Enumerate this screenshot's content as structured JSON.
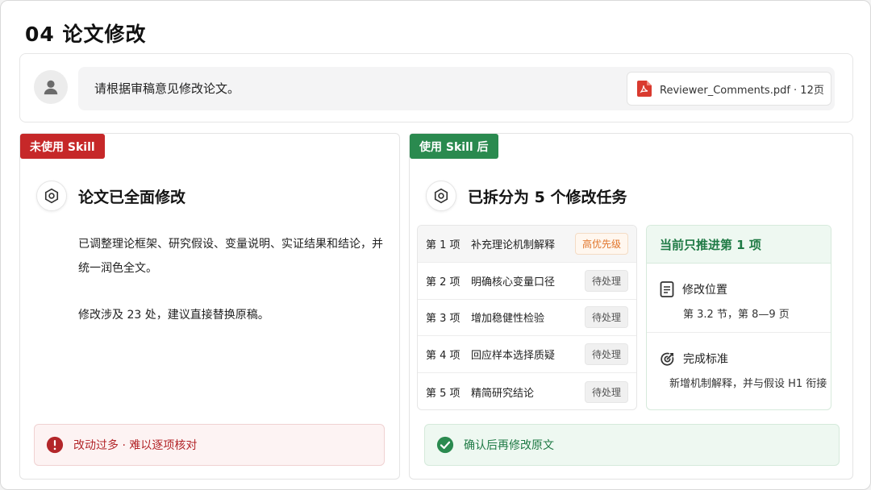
{
  "page": {
    "title": "04 论文修改"
  },
  "prompt": {
    "text": "请根据审稿意见修改论文。",
    "file_name": "Reviewer_Comments.pdf · 12页",
    "file_icon": "pdf-icon",
    "avatar_icon": "user-icon"
  },
  "left_panel": {
    "tag": "未使用 Skill",
    "tag_color": "#c62829",
    "heading": "论文已全面修改",
    "paragraphs": [
      "已调整理论框架、研究假设、变量说明、实证结果和结论，并统一润色全文。",
      "修改涉及 23 处，建议直接替换原稿。"
    ],
    "alert": "改动过多 · 难以逐项核对",
    "alert_icon": "exclamation-circle-icon"
  },
  "right_panel": {
    "tag": "使用 Skill 后",
    "tag_color": "#2a8a4f",
    "heading": "已拆分为 5 个修改任务",
    "tasks": [
      {
        "num": "第 1 项",
        "name": "补充理论机制解释",
        "status": "高优先级"
      },
      {
        "num": "第 2 项",
        "name": "明确核心变量口径",
        "status": "待处理"
      },
      {
        "num": "第 3 项",
        "name": "增加稳健性检验",
        "status": "待处理"
      },
      {
        "num": "第 4 项",
        "name": "回应样本选择质疑",
        "status": "待处理"
      },
      {
        "num": "第 5 项",
        "name": "精简研究结论",
        "status": "待处理"
      }
    ],
    "focus": {
      "title": "当前只推进第 1 项",
      "location_label": "修改位置",
      "location_value": "第 3.2 节，第 8—9 页",
      "criteria_label": "完成标准",
      "criteria_value": "新增机制解释，并与假设 H1 衔接"
    },
    "confirm": "确认后再修改原文",
    "confirm_icon": "check-circle-icon"
  }
}
